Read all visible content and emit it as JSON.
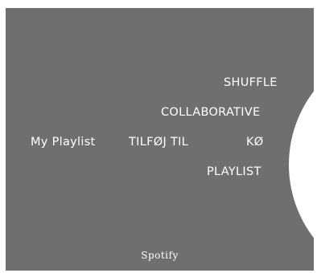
{
  "colors": {
    "panel_background": "#6f6f6f",
    "text": "#ffffff",
    "wheel": "#ffffff"
  },
  "context": {
    "title": "My Playlist"
  },
  "menu": {
    "items": [
      {
        "label": "SHUFFLE"
      },
      {
        "label": "COLLABORATIVE"
      },
      {
        "label": "TILFØJ TIL"
      },
      {
        "label": "KØ"
      },
      {
        "label": "PLAYLIST"
      }
    ]
  },
  "footer": {
    "brand": "Spotify"
  }
}
